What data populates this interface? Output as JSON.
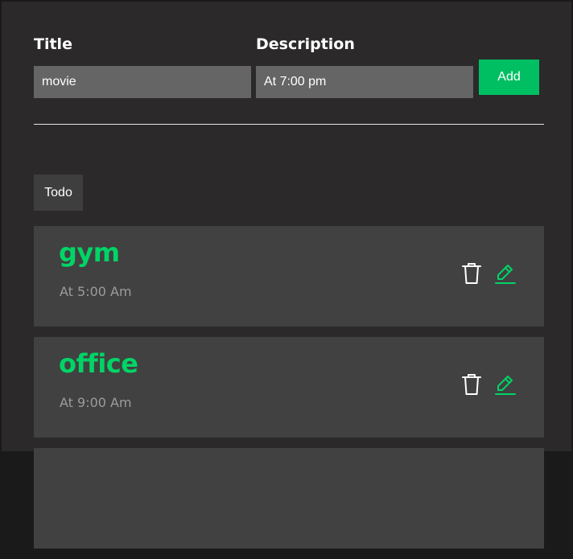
{
  "form": {
    "title_label": "Title",
    "description_label": "Description",
    "title_value": "movie",
    "description_value": "At 7:00 pm",
    "add_label": "Add"
  },
  "tabs": [
    {
      "label": "Todo"
    }
  ],
  "todos": [
    {
      "title": "gym",
      "description": "At 5:00 Am"
    },
    {
      "title": "office",
      "description": "At 9:00 Am"
    }
  ],
  "icons": {
    "delete": "trash-icon",
    "edit": "pencil-icon"
  },
  "colors": {
    "accent": "#00bf63",
    "title_green": "#00d466",
    "background": "#2b292a",
    "card": "#414141",
    "input": "#656565"
  }
}
